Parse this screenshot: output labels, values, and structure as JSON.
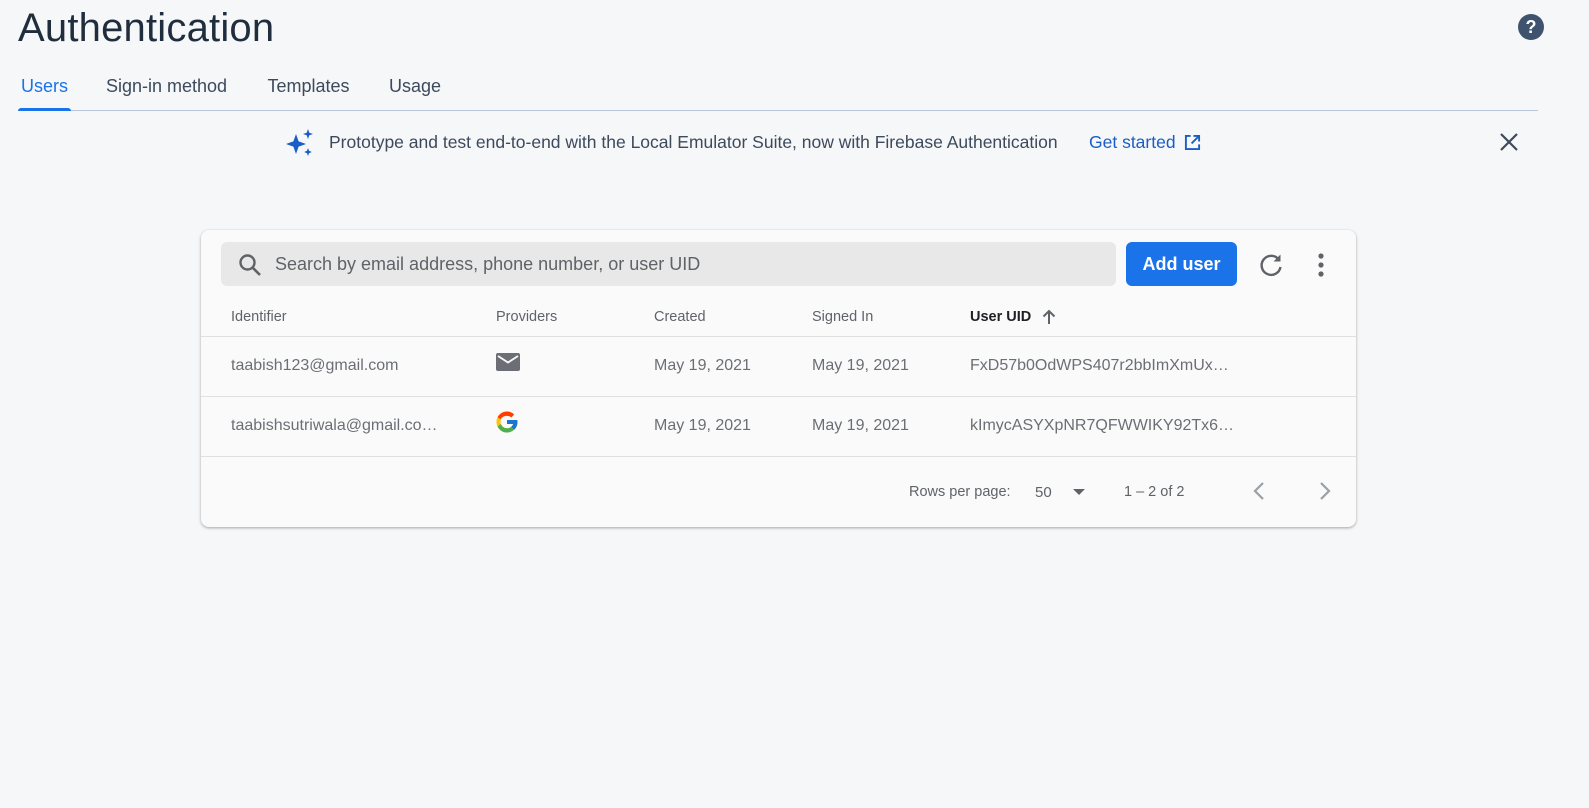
{
  "header": {
    "title": "Authentication",
    "help_icon": "help-circle-icon"
  },
  "tabs": [
    {
      "label": "Users",
      "active": true
    },
    {
      "label": "Sign-in method",
      "active": false
    },
    {
      "label": "Templates",
      "active": false
    },
    {
      "label": "Usage",
      "active": false
    }
  ],
  "banner": {
    "icon": "sparkle-icon",
    "text": "Prototype and test end-to-end with the Local Emulator Suite, now with Firebase Authentication",
    "link_label": "Get started",
    "link_icon": "open-in-new-icon",
    "close_icon": "close-icon"
  },
  "users_table": {
    "search": {
      "placeholder": "Search by email address, phone number, or user UID",
      "value": ""
    },
    "add_user_label": "Add user",
    "columns": [
      "Identifier",
      "Providers",
      "Created",
      "Signed In",
      "User UID"
    ],
    "sorted_column": "User UID",
    "sort_direction": "ascending",
    "rows": [
      {
        "identifier": "taabish123@gmail.com",
        "provider": "email-icon",
        "created": "May 19, 2021",
        "signed_in": "May 19, 2021",
        "uid": "FxD57b0OdWPS407r2bbImXmUx…"
      },
      {
        "identifier": "taabishsutriwala@gmail.co…",
        "provider": "google-icon",
        "created": "May 19, 2021",
        "signed_in": "May 19, 2021",
        "uid": "kImycASYXpNR7QFWWIKY92Tx6…"
      }
    ],
    "pagination": {
      "rows_per_page_label": "Rows per page:",
      "rows_per_page_value": "50",
      "range_text": "1 – 2 of 2"
    }
  },
  "colors": {
    "accent": "#1a73e8",
    "background": "#f6f7f9",
    "title": "#1f2d3d"
  }
}
